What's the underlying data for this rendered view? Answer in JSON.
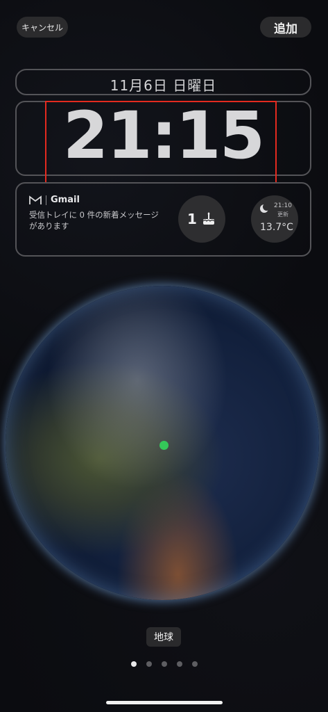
{
  "header": {
    "cancel_label": "キャンセル",
    "add_label": "追加"
  },
  "lockscreen": {
    "date": "11月6日 日曜日",
    "time": "21:15"
  },
  "widgets": {
    "gmail": {
      "title": "Gmail",
      "message": "受信トレイに 0 件の新着メッセージがあります"
    },
    "birthday": {
      "count": "1"
    },
    "weather": {
      "time": "21:10",
      "update_label": "更新",
      "temperature": "13.7°C"
    }
  },
  "wallpaper": {
    "name": "地球",
    "page_count": 5,
    "active_page": 1
  },
  "colors": {
    "highlight": "#e42a1f",
    "location_dot": "#34c759"
  }
}
